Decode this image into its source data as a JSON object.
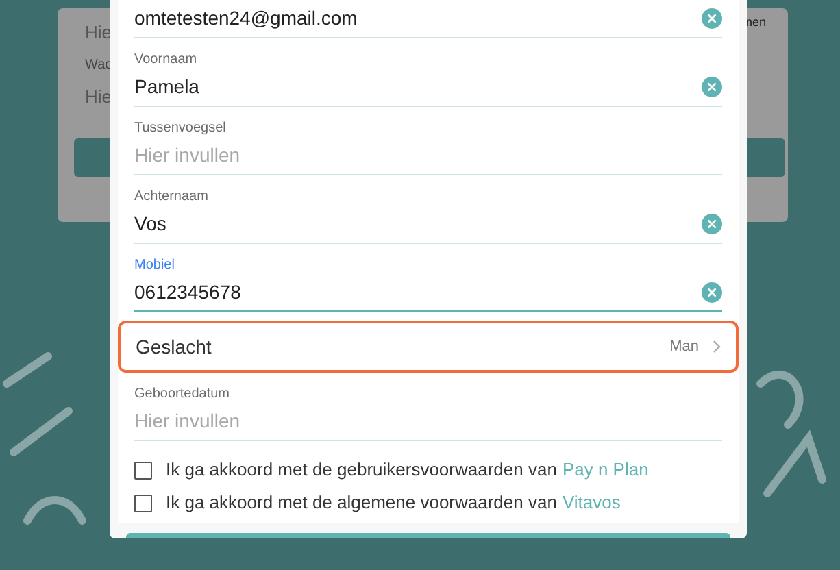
{
  "background_form": {
    "left_texts": [
      "Hie",
      "Wac",
      "Hie"
    ],
    "right_text": "nen"
  },
  "fields": [
    {
      "kind": "text",
      "value": "omtetesten24@gmail.com",
      "focused": false,
      "clearable": true
    },
    {
      "kind": "text",
      "label": "Voornaam",
      "value": "Pamela",
      "focused": false,
      "clearable": true
    },
    {
      "kind": "text",
      "label": "Tussenvoegsel",
      "placeholder": "Hier invullen",
      "focused": false,
      "clearable": false
    },
    {
      "kind": "text",
      "label": "Achternaam",
      "value": "Vos",
      "focused": false,
      "clearable": true
    },
    {
      "kind": "text",
      "label": "Mobiel",
      "value": "0612345678",
      "focused": true,
      "clearable": true
    },
    {
      "kind": "select",
      "label": "Geslacht",
      "value": "Man",
      "highlighted": true
    },
    {
      "kind": "text",
      "label": "Geboortedatum",
      "placeholder": "Hier invullen",
      "focused": false,
      "clearable": false
    }
  ],
  "agreements": [
    {
      "text": "Ik ga akkoord met de gebruikersvoorwaarden van",
      "link": "Pay n Plan",
      "checked": false
    },
    {
      "text": "Ik ga akkoord met de algemene voorwaarden van",
      "link": "Vitavos",
      "checked": false
    }
  ]
}
